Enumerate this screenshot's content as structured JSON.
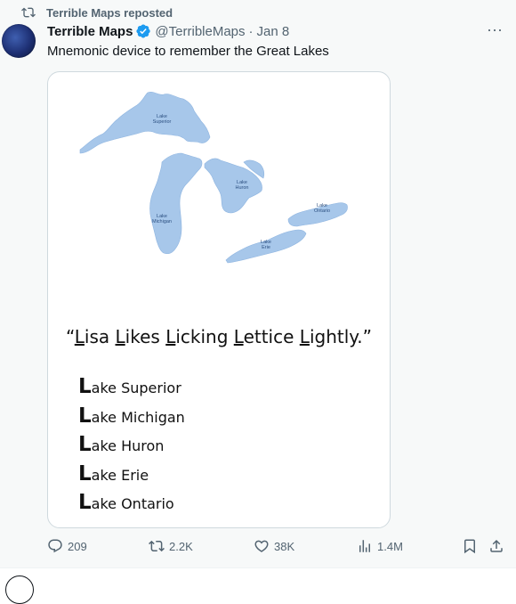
{
  "repost": {
    "label": "Terrible Maps reposted",
    "icon": "repost-icon"
  },
  "author": {
    "name": "Terrible Maps",
    "handle": "@TerribleMaps",
    "date": "Jan 8",
    "verified": true
  },
  "post_text": "Mnemonic device to remember the Great Lakes",
  "image": {
    "map_labels": {
      "superior": "Lake Superior",
      "michigan": "Lake Michigan",
      "huron": "Lake Huron",
      "erie": "Lake Erie",
      "ontario": "Lake Ontario"
    },
    "mnemonic": {
      "open_quote": "“",
      "words": [
        {
          "first": "L",
          "rest": "isa"
        },
        {
          "first": "L",
          "rest": "ikes"
        },
        {
          "first": "L",
          "rest": "icking"
        },
        {
          "first": "L",
          "rest": "ettice"
        },
        {
          "first": "L",
          "rest": "ightly."
        }
      ],
      "close_quote": "”"
    },
    "lakes": [
      {
        "initial": "L",
        "rest": "ake Superior"
      },
      {
        "initial": "L",
        "rest": "ake Michigan"
      },
      {
        "initial": "L",
        "rest": "ake Huron"
      },
      {
        "initial": "L",
        "rest": "ake Erie"
      },
      {
        "initial": "L",
        "rest": "ake Ontario"
      }
    ],
    "lake_color": "#a7c7ea"
  },
  "actions": {
    "replies": "209",
    "reposts": "2.2K",
    "likes": "38K",
    "views": "1.4M"
  },
  "colors": {
    "secondary_text": "#536471",
    "verified": "#1d9bf0",
    "background": "#f7f9f9"
  }
}
